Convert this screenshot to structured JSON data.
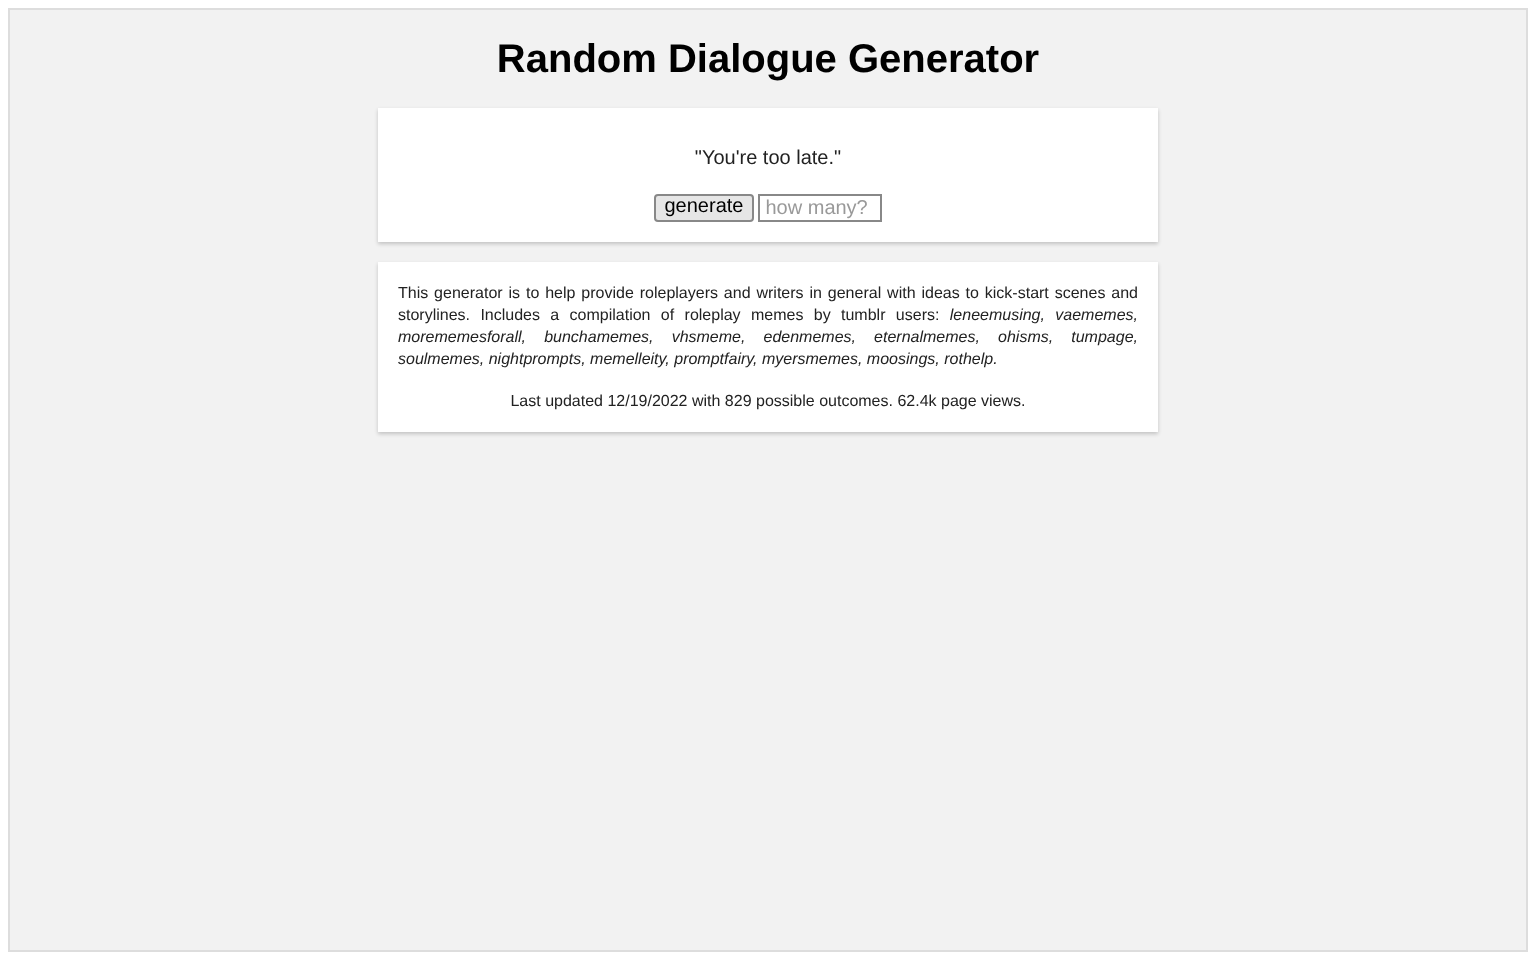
{
  "title": "Random Dialogue Generator",
  "output": {
    "text": "\"You're too late.\""
  },
  "generate_button": {
    "label": "generate"
  },
  "count_field": {
    "placeholder": "how many?"
  },
  "about": {
    "description": "This generator is to help provide roleplayers and writers in general with ideas to kick-start scenes and storylines. Includes a compilation of roleplay memes by tumblr users: *leneemusing, vaememes, morememesforall, bunchamemes, vhsmeme, edenmemes, eternalmemes, ohisms, tumpage, soulmemes, nightprompts, memelleity, promptfairy, myersmemes, moosings, rothelp.*",
    "updated": "Last updated 12/19/2022 with 829 possible outcomes. 62.4k page views."
  }
}
